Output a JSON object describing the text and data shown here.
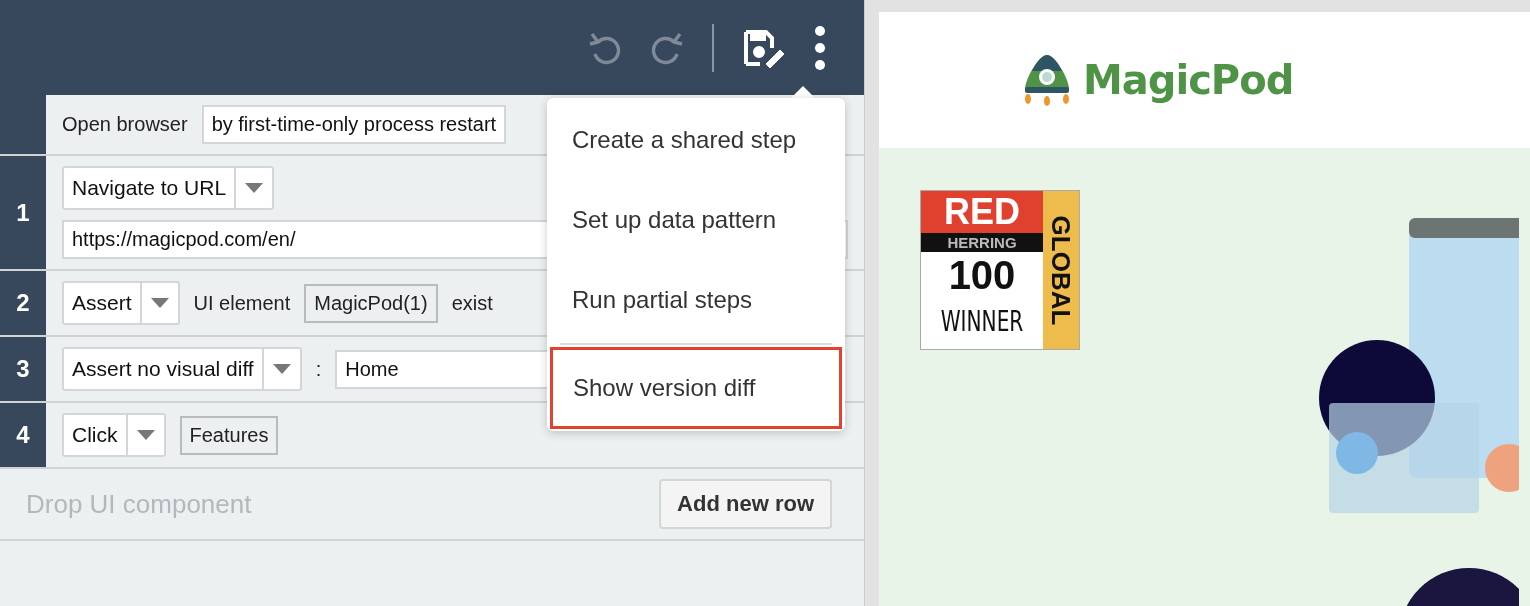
{
  "toolbar": {
    "buttons": [
      {
        "kind": "undo",
        "disabled": true
      },
      {
        "kind": "redo",
        "disabled": true
      },
      {
        "kind": "save",
        "disabled": false
      },
      {
        "kind": "more",
        "disabled": false
      }
    ]
  },
  "steps": [
    {
      "parts": [
        {
          "kind": "label",
          "text": "Open browser"
        },
        {
          "kind": "input",
          "text": "by first-time-only process restart"
        }
      ]
    },
    {
      "number": "1",
      "parts": [
        {
          "kind": "select",
          "text": "Navigate to URL"
        },
        {
          "kind": "wide_input",
          "text": "https://magicpod.com/en/"
        }
      ]
    },
    {
      "number": "2",
      "parts": [
        {
          "kind": "select",
          "text": "Assert"
        },
        {
          "kind": "label",
          "text": "UI element"
        },
        {
          "kind": "element",
          "text": "MagicPod(1)"
        },
        {
          "kind": "label",
          "text": "exist"
        }
      ]
    },
    {
      "number": "3",
      "parts": [
        {
          "kind": "select",
          "text": "Assert no visual diff"
        },
        {
          "kind": "label",
          "text": ":"
        },
        {
          "kind": "input",
          "text": "Home"
        }
      ]
    },
    {
      "number": "4",
      "parts": [
        {
          "kind": "select",
          "text": "Click"
        },
        {
          "kind": "element",
          "text": "Features"
        }
      ]
    }
  ],
  "drop_zone": {
    "placeholder": "Drop UI component"
  },
  "add_row_button": "Add new row",
  "menu": {
    "items": [
      {
        "kind": "action",
        "label": "Create a shared step",
        "highlighted": false
      },
      {
        "kind": "action",
        "label": "Set up data pattern",
        "highlighted": false
      },
      {
        "kind": "action",
        "label": "Run partial steps",
        "highlighted": false
      },
      {
        "kind": "divider"
      },
      {
        "kind": "action",
        "label": "Show version diff",
        "highlighted": true
      }
    ]
  },
  "preview": {
    "logo": "MagicPod",
    "badge": {
      "top": "RED",
      "band": "HERRING",
      "number": "100",
      "bottom": "WINNER",
      "side": "GLOBAL"
    }
  }
}
